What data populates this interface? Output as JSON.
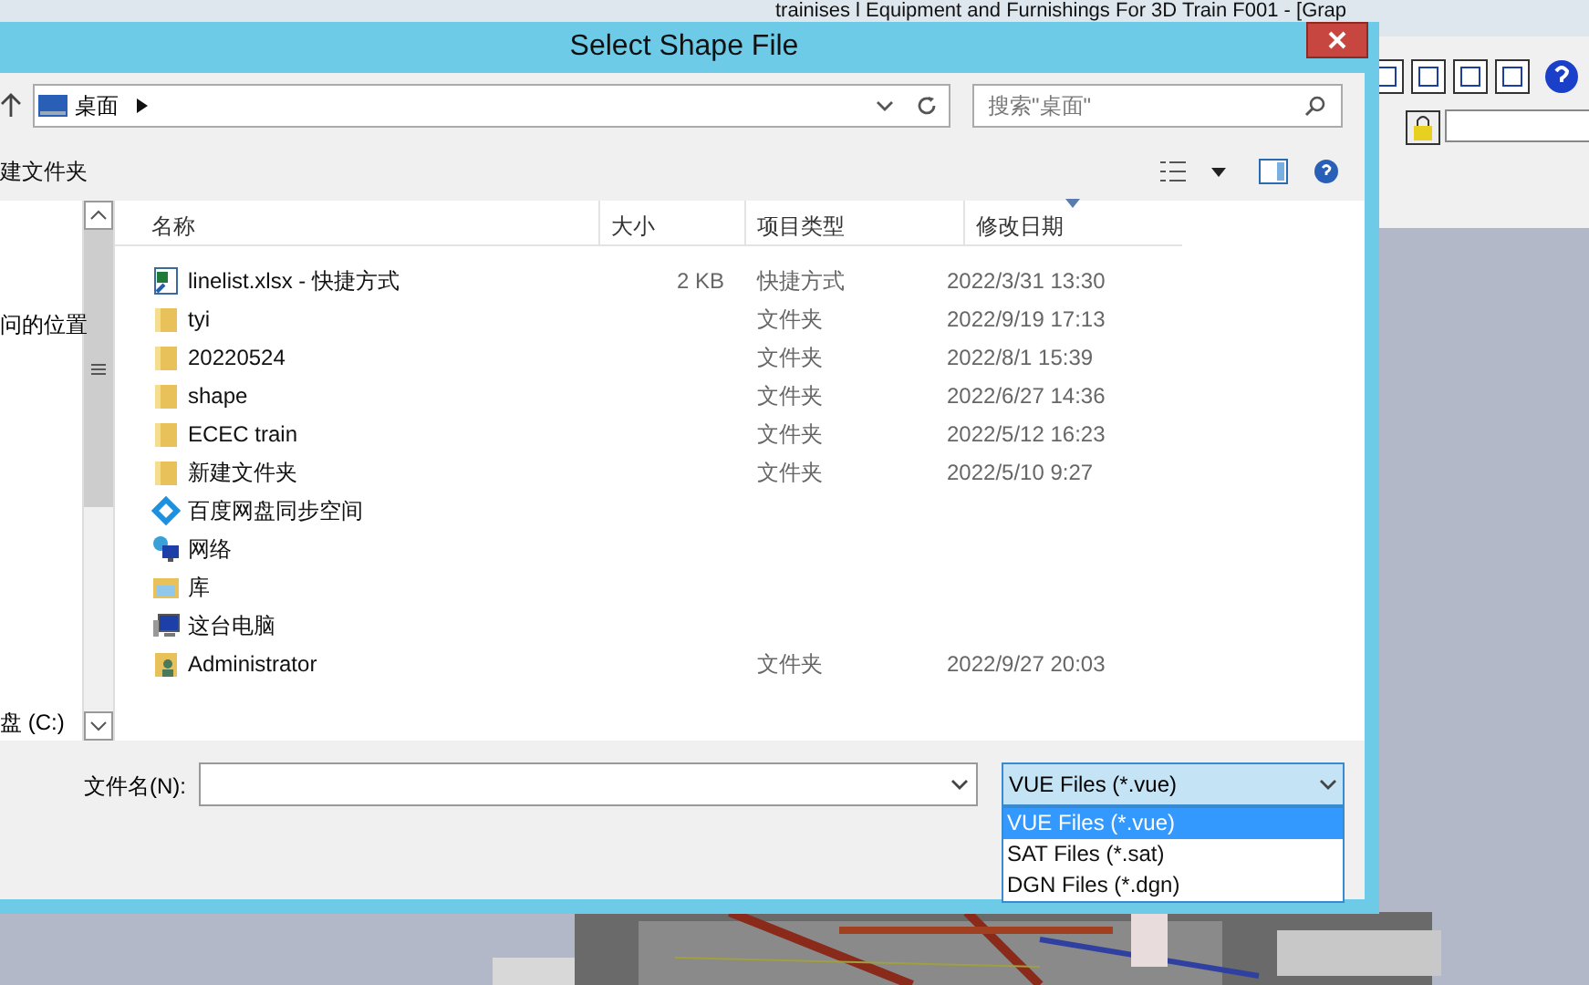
{
  "app": {
    "title": "trainises l Equipment and Furnishings For 3D Train F001 - [Grap"
  },
  "dialog": {
    "title": "Select Shape File",
    "address": {
      "location": "桌面",
      "search_placeholder": "搜索\"桌面\""
    },
    "toolbar": {
      "new_folder": "建文件夹"
    },
    "nav_pane": {
      "items": [
        "问的位置",
        "盘 (C:)"
      ]
    },
    "columns": [
      "名称",
      "大小",
      "项目类型",
      "修改日期"
    ],
    "rows": [
      {
        "kind": "shortcut",
        "name": "linelist.xlsx - 快捷方式",
        "size": "2 KB",
        "type": "快捷方式",
        "modified": "2022/3/31 13:30"
      },
      {
        "kind": "folder",
        "name": "tyi",
        "type": "文件夹",
        "modified": "2022/9/19 17:13"
      },
      {
        "kind": "folder",
        "name": "20220524",
        "type": "文件夹",
        "modified": "2022/8/1 15:39"
      },
      {
        "kind": "folder",
        "name": "shape",
        "type": "文件夹",
        "modified": "2022/6/27 14:36"
      },
      {
        "kind": "folder",
        "name": "ECEC train",
        "type": "文件夹",
        "modified": "2022/5/12 16:23"
      },
      {
        "kind": "folder",
        "name": "新建文件夹",
        "type": "文件夹",
        "modified": "2022/5/10 9:27"
      },
      {
        "kind": "cloud",
        "name": "百度网盘同步空间"
      },
      {
        "kind": "network",
        "name": "网络"
      },
      {
        "kind": "library",
        "name": "库"
      },
      {
        "kind": "computer",
        "name": "这台电脑"
      },
      {
        "kind": "user",
        "name": "Administrator",
        "type": "文件夹",
        "modified": "2022/9/27 20:03"
      }
    ],
    "filename_label": "文件名(N):",
    "filter": {
      "value": "VUE Files (*.vue)",
      "options": [
        {
          "label": "VUE Files (*.vue)",
          "selected": true
        },
        {
          "label": "SAT Files (*.sat)",
          "selected": false
        },
        {
          "label": "DGN Files (*.dgn)",
          "selected": false
        }
      ]
    }
  }
}
